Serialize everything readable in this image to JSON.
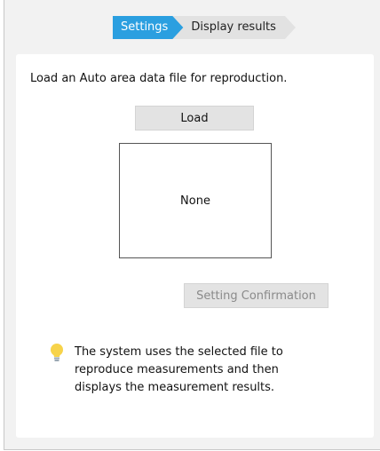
{
  "stepper": {
    "steps": [
      "Settings",
      "Display results"
    ],
    "active_index": 0,
    "active_color": "#2b9fe0"
  },
  "instruction": "Load an Auto area data file for reproduction.",
  "load_button_label": "Load",
  "file_display": "None",
  "confirm_button_label": "Setting Confirmation",
  "tip": {
    "icon": "lightbulb-icon",
    "text": "The system uses the selected file to reproduce measurements and then displays the measurement results."
  }
}
